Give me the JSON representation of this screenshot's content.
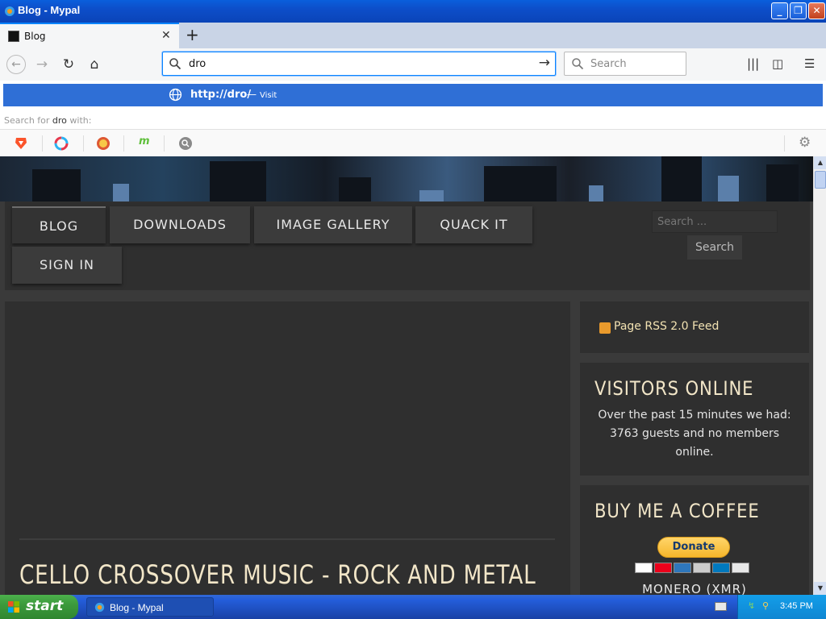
{
  "window": {
    "title": "Blog - Mypal"
  },
  "tabs": [
    {
      "label": "Blog"
    }
  ],
  "toolbar": {
    "new_tab_label": "+"
  },
  "urlbar": {
    "value": "dro"
  },
  "searchbar": {
    "placeholder": "Search"
  },
  "autocomplete": {
    "suggestion_url": "http://dro/",
    "suggestion_sep": "—",
    "suggestion_action": "Visit",
    "search_with_prefix": "Search for",
    "search_with_term": "dro",
    "search_with_suffix": "with:"
  },
  "site": {
    "nav": [
      "BLOG",
      "DOWNLOADS",
      "IMAGE GALLERY",
      "QUACK IT",
      "SIGN IN"
    ],
    "search_placeholder": "Search ...",
    "search_button": "Search",
    "article_title": "CELLO CROSSOVER MUSIC - ROCK AND METAL",
    "rss_link": "Page RSS 2.0 Feed",
    "visitors_title": "VISITORS ONLINE",
    "visitors_text": "Over the past 15 minutes we had: 3763 guests and no members online.",
    "coffee_title": "BUY ME A COFFEE",
    "donate_label": "Donate",
    "monero_label": "MONERO (XMR)"
  },
  "taskbar": {
    "start_label": "start",
    "task_label": "Blog - Mypal",
    "clock": "3:45 PM"
  },
  "colors": {
    "accent": "#0a84ff",
    "suggestion_bg": "#2f6fd6",
    "page_bg": "#3a3a3a",
    "title_text": "#f2e6c8"
  }
}
